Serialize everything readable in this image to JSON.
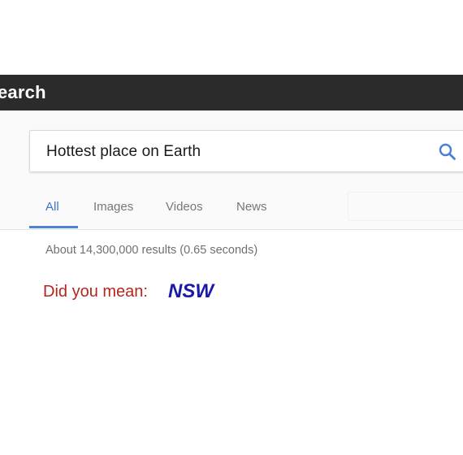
{
  "app": {
    "title_partial": "earch"
  },
  "search": {
    "query": "Hottest place on Earth",
    "icon": "search-icon"
  },
  "tabs": [
    {
      "label": "All",
      "active": true
    },
    {
      "label": "Images",
      "active": false
    },
    {
      "label": "Videos",
      "active": false
    },
    {
      "label": "News",
      "active": false
    }
  ],
  "results": {
    "stats": "About 14,300,000 results (0.65 seconds)",
    "did_you_mean_label": "Did you mean:",
    "did_you_mean_suggestion": "NSW"
  },
  "colors": {
    "topbar": "#2b2b2b",
    "active_tab": "#4273c0",
    "did_you_mean": "#b3261e",
    "suggestion": "#1a1aa6"
  }
}
